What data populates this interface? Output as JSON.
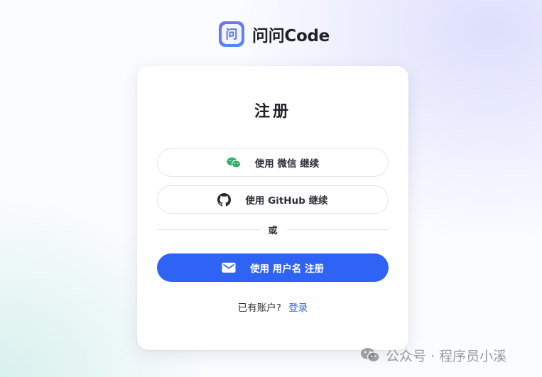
{
  "brand": {
    "name": "问问Code",
    "logo_glyph": "问",
    "logo_icon": "wenwen-logo-icon"
  },
  "card": {
    "title": "注册",
    "wechat_button": {
      "label": "使用 微信 继续",
      "icon": "wechat-icon",
      "icon_color": "#2aae67"
    },
    "github_button": {
      "label": "使用 GitHub 继续",
      "icon": "github-icon"
    },
    "divider_text": "或",
    "username_button": {
      "label": "使用 用户名 注册",
      "icon": "mail-icon"
    },
    "footer": {
      "prompt": "已有账户?",
      "link": "登录"
    }
  },
  "watermark": {
    "text": "公众号 · 程序员小溪",
    "icon": "wechat-icon"
  },
  "colors": {
    "primary": "#2f63f5",
    "text": "#1f2329",
    "border": "#e3e5e8"
  }
}
